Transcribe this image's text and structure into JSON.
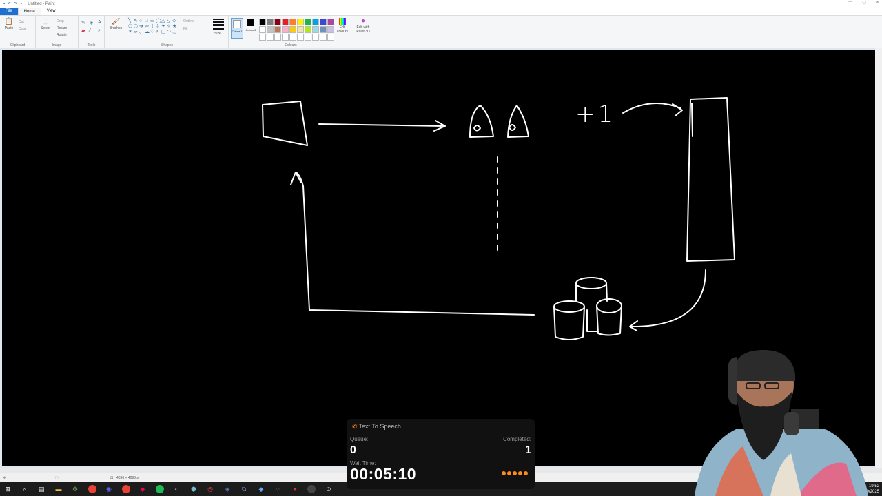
{
  "window": {
    "title": "Untitled - Paint",
    "tabs": [
      "File",
      "Home",
      "View"
    ],
    "active_tab": "Home"
  },
  "ribbon": {
    "clipboard": {
      "label": "Clipboard",
      "paste": "Paste",
      "cut": "Cut",
      "copy": "Copy"
    },
    "image": {
      "label": "Image",
      "select": "Select",
      "crop": "Crop",
      "resize": "Resize",
      "rotate": "Rotate"
    },
    "tools": {
      "label": "Tools"
    },
    "brushes": {
      "label": "Brushes"
    },
    "shapes": {
      "label": "Shapes",
      "outline": "Outline",
      "fill": "Fill"
    },
    "size": {
      "label": "Size"
    },
    "colours": {
      "label": "Colours",
      "colour1": "Colour 1",
      "colour2": "Colour 2",
      "edit_colours": "Edit colours",
      "edit_paint3d": "Edit with Paint 3D",
      "palette": [
        "#000000",
        "#7f7f7f",
        "#880015",
        "#ed1c24",
        "#ff7f27",
        "#fff200",
        "#22b14c",
        "#00a2e8",
        "#3f48cc",
        "#a349a4",
        "#ffffff",
        "#c3c3c3",
        "#b97a57",
        "#ffaec9",
        "#ffc90e",
        "#efe4b0",
        "#b5e61d",
        "#99d9ea",
        "#7092be",
        "#c8bfe7",
        "#ffffff",
        "#ffffff",
        "#ffffff",
        "#ffffff",
        "#ffffff",
        "#ffffff",
        "#ffffff",
        "#ffffff",
        "#ffffff",
        "#ffffff"
      ]
    }
  },
  "canvas": {
    "text_marks": [
      "+1"
    ]
  },
  "statusbar": {
    "dimensions": "4096 × 4096px"
  },
  "tts": {
    "title": "Text To Speech",
    "queue_label": "Queue:",
    "queue_value": "0",
    "completed_label": "Completed:",
    "completed_value": "1",
    "wait_label": "Wait Time:",
    "wait_value": "00:05:10"
  },
  "taskbar": {
    "time": "19:52",
    "date": "16/09/2025"
  }
}
